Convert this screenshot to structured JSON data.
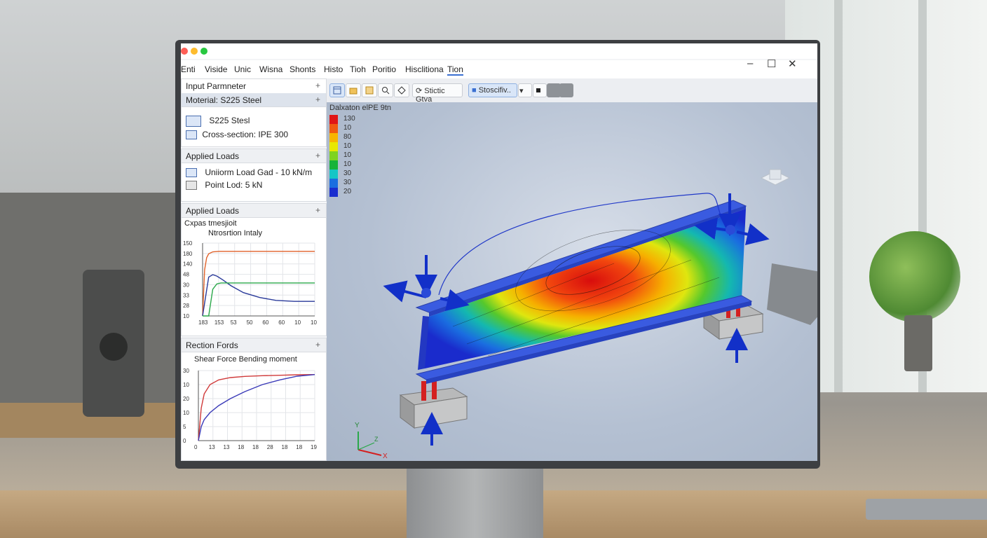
{
  "window": {
    "traffic_colors": [
      "#ff5f57",
      "#febc2e",
      "#28c840"
    ],
    "controls": [
      "–",
      "☐",
      "✕"
    ]
  },
  "menu": {
    "items": [
      "Enti",
      "Viside",
      "Unic",
      "Wisna",
      "Shonts",
      "Histo",
      "Tioh",
      "Poritio",
      "Hisclitiona",
      "Tion"
    ],
    "active_index": 9
  },
  "left_panel": {
    "input_params": {
      "title": "Input Parmneter",
      "material_header": "Moterial: S225 Steel",
      "material_value": "S225 Stesl",
      "cross_section": "Cross-section: IPE 300"
    },
    "applied_loads": {
      "title": "Applied Loads",
      "uniform_load": "Uniiorm Load Gad - 10 kN/m",
      "point_load": "Point Lod: 5 kN"
    },
    "applied_loads_2": {
      "title": "Applied Loads",
      "chart_caption": "Cxpas tmesjioit",
      "chart_subcaption": "Ntrosrtion Intaly"
    },
    "reaction_forces": {
      "title": "Rection Fords",
      "chart_caption": "Shear Force Bending moment"
    }
  },
  "toolbar": {
    "button_icons": [
      "results-icon",
      "folder-icon",
      "save-icon",
      "zoom-icon",
      "shape-icon"
    ],
    "static_view_label": "Stictic Gtva",
    "simulation_label": "Stoscifiv..",
    "dropdown_arrow": "▾",
    "extra_icons": [
      "dot-icon",
      "square-icon",
      "square-icon"
    ]
  },
  "viewport": {
    "title": "Dalxaton elPE 9tn",
    "legend_labels": [
      "130",
      "10",
      "80",
      "10",
      "10",
      "10",
      "30",
      "30",
      "20"
    ],
    "legend_colors": [
      "#e01515",
      "#f05a10",
      "#f7b500",
      "#e8e800",
      "#7ed321",
      "#16b33a",
      "#15c6c6",
      "#1a6ee0",
      "#1a2ecf"
    ],
    "axes": {
      "x": "X",
      "y": "Y",
      "z": "Z"
    }
  },
  "chart_data": [
    {
      "type": "line",
      "title": "Ntrosrtion Intaly",
      "subtitle": "Cxpas tmesjioit",
      "x_tick_labels": [
        "183",
        "153",
        "53",
        "50",
        "60",
        "60",
        "10",
        "10"
      ],
      "y_tick_labels": [
        "150",
        "180",
        "140",
        "48",
        "30",
        "33",
        "28",
        "10"
      ],
      "series": [
        {
          "color": "#e0622a",
          "x": [
            0,
            1,
            2,
            3,
            5,
            8,
            12,
            18,
            25,
            35,
            45,
            55
          ],
          "y": [
            0,
            95,
            120,
            128,
            132,
            133,
            133,
            133,
            133,
            133,
            133,
            133
          ]
        },
        {
          "color": "#2a3a9a",
          "x": [
            0,
            3,
            5,
            7,
            10,
            14,
            20,
            28,
            36,
            45,
            55
          ],
          "y": [
            0,
            80,
            85,
            82,
            74,
            62,
            48,
            38,
            32,
            30,
            30
          ]
        },
        {
          "color": "#2aa84a",
          "x": [
            0,
            3,
            5,
            7,
            9,
            55
          ],
          "y": [
            0,
            0,
            55,
            66,
            68,
            68
          ]
        }
      ]
    },
    {
      "type": "line",
      "title": "Shear Force Bending moment",
      "x_tick_labels": [
        "0",
        "13",
        "13",
        "18",
        "18",
        "28",
        "18",
        "18",
        "19"
      ],
      "y_tick_labels": [
        "30",
        "10",
        "20",
        "10",
        "5",
        "0"
      ],
      "series": [
        {
          "color": "#d03a3a",
          "x": [
            0,
            1,
            2,
            4,
            7,
            11,
            16,
            22,
            28,
            34,
            40
          ],
          "y": [
            0,
            14,
            20,
            24,
            26,
            27,
            27.5,
            27.8,
            28,
            28.2,
            28.3
          ]
        },
        {
          "color": "#3a3ab8",
          "x": [
            0,
            1,
            2,
            4,
            7,
            11,
            16,
            22,
            28,
            34,
            40
          ],
          "y": [
            0,
            6,
            9,
            12,
            15,
            18,
            21,
            24,
            26,
            27.6,
            28.3
          ]
        }
      ]
    }
  ]
}
